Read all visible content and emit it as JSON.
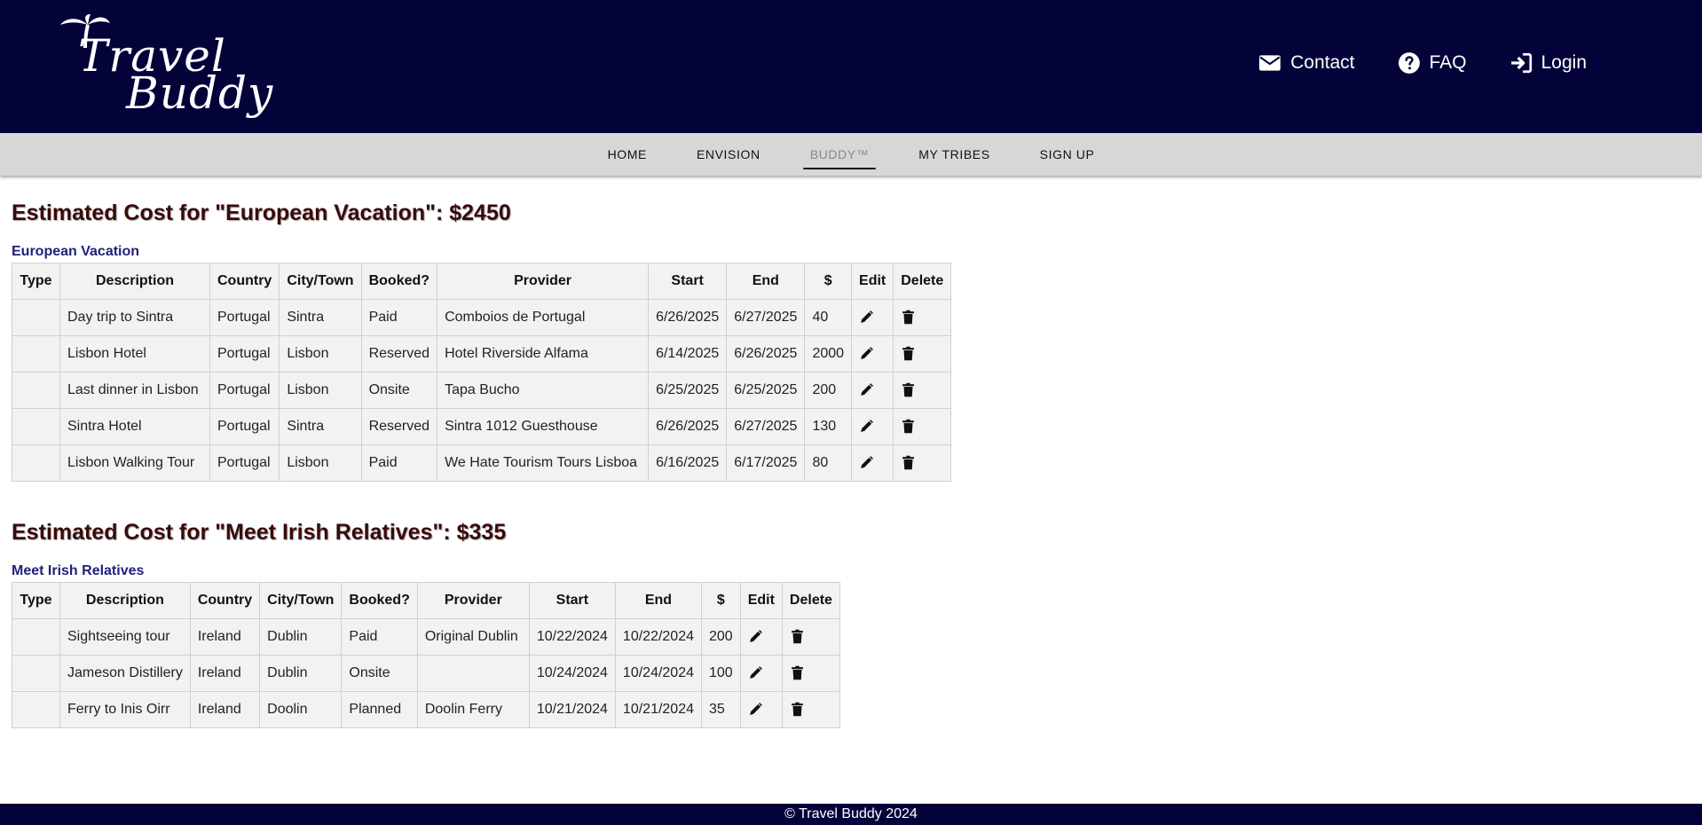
{
  "header": {
    "logo": {
      "line1": "Travel",
      "line2": "Buddy"
    },
    "links": [
      {
        "label": "Contact",
        "icon": "envelope-icon"
      },
      {
        "label": "FAQ",
        "icon": "question-circle-icon"
      },
      {
        "label": "Login",
        "icon": "sign-in-icon"
      }
    ]
  },
  "nav": {
    "items": [
      "HOME",
      "ENVISION",
      "BUDDY™",
      "MY TRIBES",
      "SIGN UP"
    ],
    "active": "BUDDY™"
  },
  "columns": [
    "Type",
    "Description",
    "Country",
    "City/Town",
    "Booked?",
    "Provider",
    "Start",
    "End",
    "$",
    "Edit",
    "Delete"
  ],
  "trips": [
    {
      "heading": "Estimated Cost for \"European Vacation\": $2450",
      "name": "European Vacation",
      "rows": [
        {
          "type": "",
          "description": "Day trip to Sintra",
          "country": "Portugal",
          "city": "Sintra",
          "booked": "Paid",
          "provider": "Comboios de Portugal",
          "start": "6/26/2025",
          "end": "6/27/2025",
          "cost": "40"
        },
        {
          "type": "",
          "description": "Lisbon Hotel",
          "country": "Portugal",
          "city": "Lisbon",
          "booked": "Reserved",
          "provider": "Hotel Riverside Alfama",
          "start": "6/14/2025",
          "end": "6/26/2025",
          "cost": "2000"
        },
        {
          "type": "",
          "description": "Last dinner in Lisbon",
          "country": "Portugal",
          "city": "Lisbon",
          "booked": "Onsite",
          "provider": "Tapa Bucho",
          "start": "6/25/2025",
          "end": "6/25/2025",
          "cost": "200"
        },
        {
          "type": "",
          "description": "Sintra Hotel",
          "country": "Portugal",
          "city": "Sintra",
          "booked": "Reserved",
          "provider": "Sintra 1012 Guesthouse",
          "start": "6/26/2025",
          "end": "6/27/2025",
          "cost": "130"
        },
        {
          "type": "",
          "description": "Lisbon Walking Tour",
          "country": "Portugal",
          "city": "Lisbon",
          "booked": "Paid",
          "provider": "We Hate Tourism Tours Lisboa",
          "start": "6/16/2025",
          "end": "6/17/2025",
          "cost": "80"
        }
      ]
    },
    {
      "heading": "Estimated Cost for \"Meet Irish Relatives\": $335",
      "name": "Meet Irish Relatives",
      "rows": [
        {
          "type": "",
          "description": "Sightseeing tour",
          "country": "Ireland",
          "city": "Dublin",
          "booked": "Paid",
          "provider": "Original Dublin",
          "start": "10/22/2024",
          "end": "10/22/2024",
          "cost": "200"
        },
        {
          "type": "",
          "description": "Jameson Distillery",
          "country": "Ireland",
          "city": "Dublin",
          "booked": "Onsite",
          "provider": "",
          "start": "10/24/2024",
          "end": "10/24/2024",
          "cost": "100"
        },
        {
          "type": "",
          "description": "Ferry to Inis Oirr",
          "country": "Ireland",
          "city": "Doolin",
          "booked": "Planned",
          "provider": "Doolin Ferry",
          "start": "10/21/2024",
          "end": "10/21/2024",
          "cost": "35"
        }
      ]
    }
  ],
  "footer": {
    "text": "© Travel Buddy 2024"
  },
  "colors": {
    "header_bg": "#03033a",
    "nav_bg": "#d7d7d7",
    "heading": "#3a0a0a",
    "trip_name": "#22207a"
  }
}
